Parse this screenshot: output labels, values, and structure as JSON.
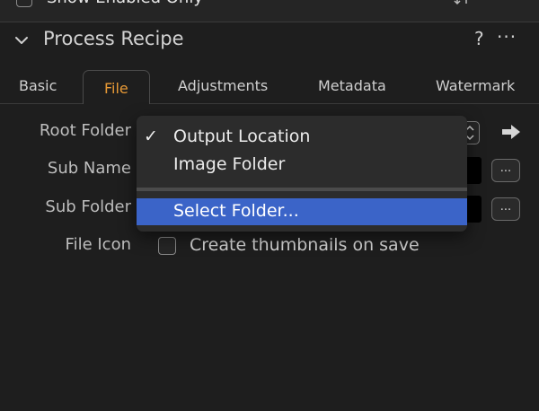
{
  "top_strip": {
    "checkbox_label": "Show Enabled Only"
  },
  "header": {
    "title": "Process Recipe",
    "help": "?",
    "more": "···"
  },
  "tabs": [
    {
      "label": "Basic",
      "active": false
    },
    {
      "label": "File",
      "active": true
    },
    {
      "label": "Adjustments",
      "active": false
    },
    {
      "label": "Metadata",
      "active": false
    },
    {
      "label": "Watermark",
      "active": false
    }
  ],
  "form": {
    "root_folder_label": "Root Folder",
    "sub_name_label": "Sub Name",
    "sub_folder_label": "Sub Folder",
    "file_icon_label": "File Icon",
    "ellipsis": "...",
    "create_thumbnails_label": "Create thumbnails on save",
    "create_thumbnails_checked": false
  },
  "dropdown": {
    "check_mark": "✓",
    "items": [
      "Output Location",
      "Image Folder",
      "Select Folder..."
    ],
    "selected": "Output Location",
    "highlighted": "Select Folder..."
  },
  "colors": {
    "accent_tab": "#e89a36",
    "menu_highlight": "#3b64c8",
    "background": "#1e1e1e"
  },
  "icons": [
    "chevron-down-icon",
    "help-icon",
    "more-icon",
    "sort-icon",
    "stepper-icon",
    "arrow-right-icon",
    "checkmark-icon"
  ]
}
